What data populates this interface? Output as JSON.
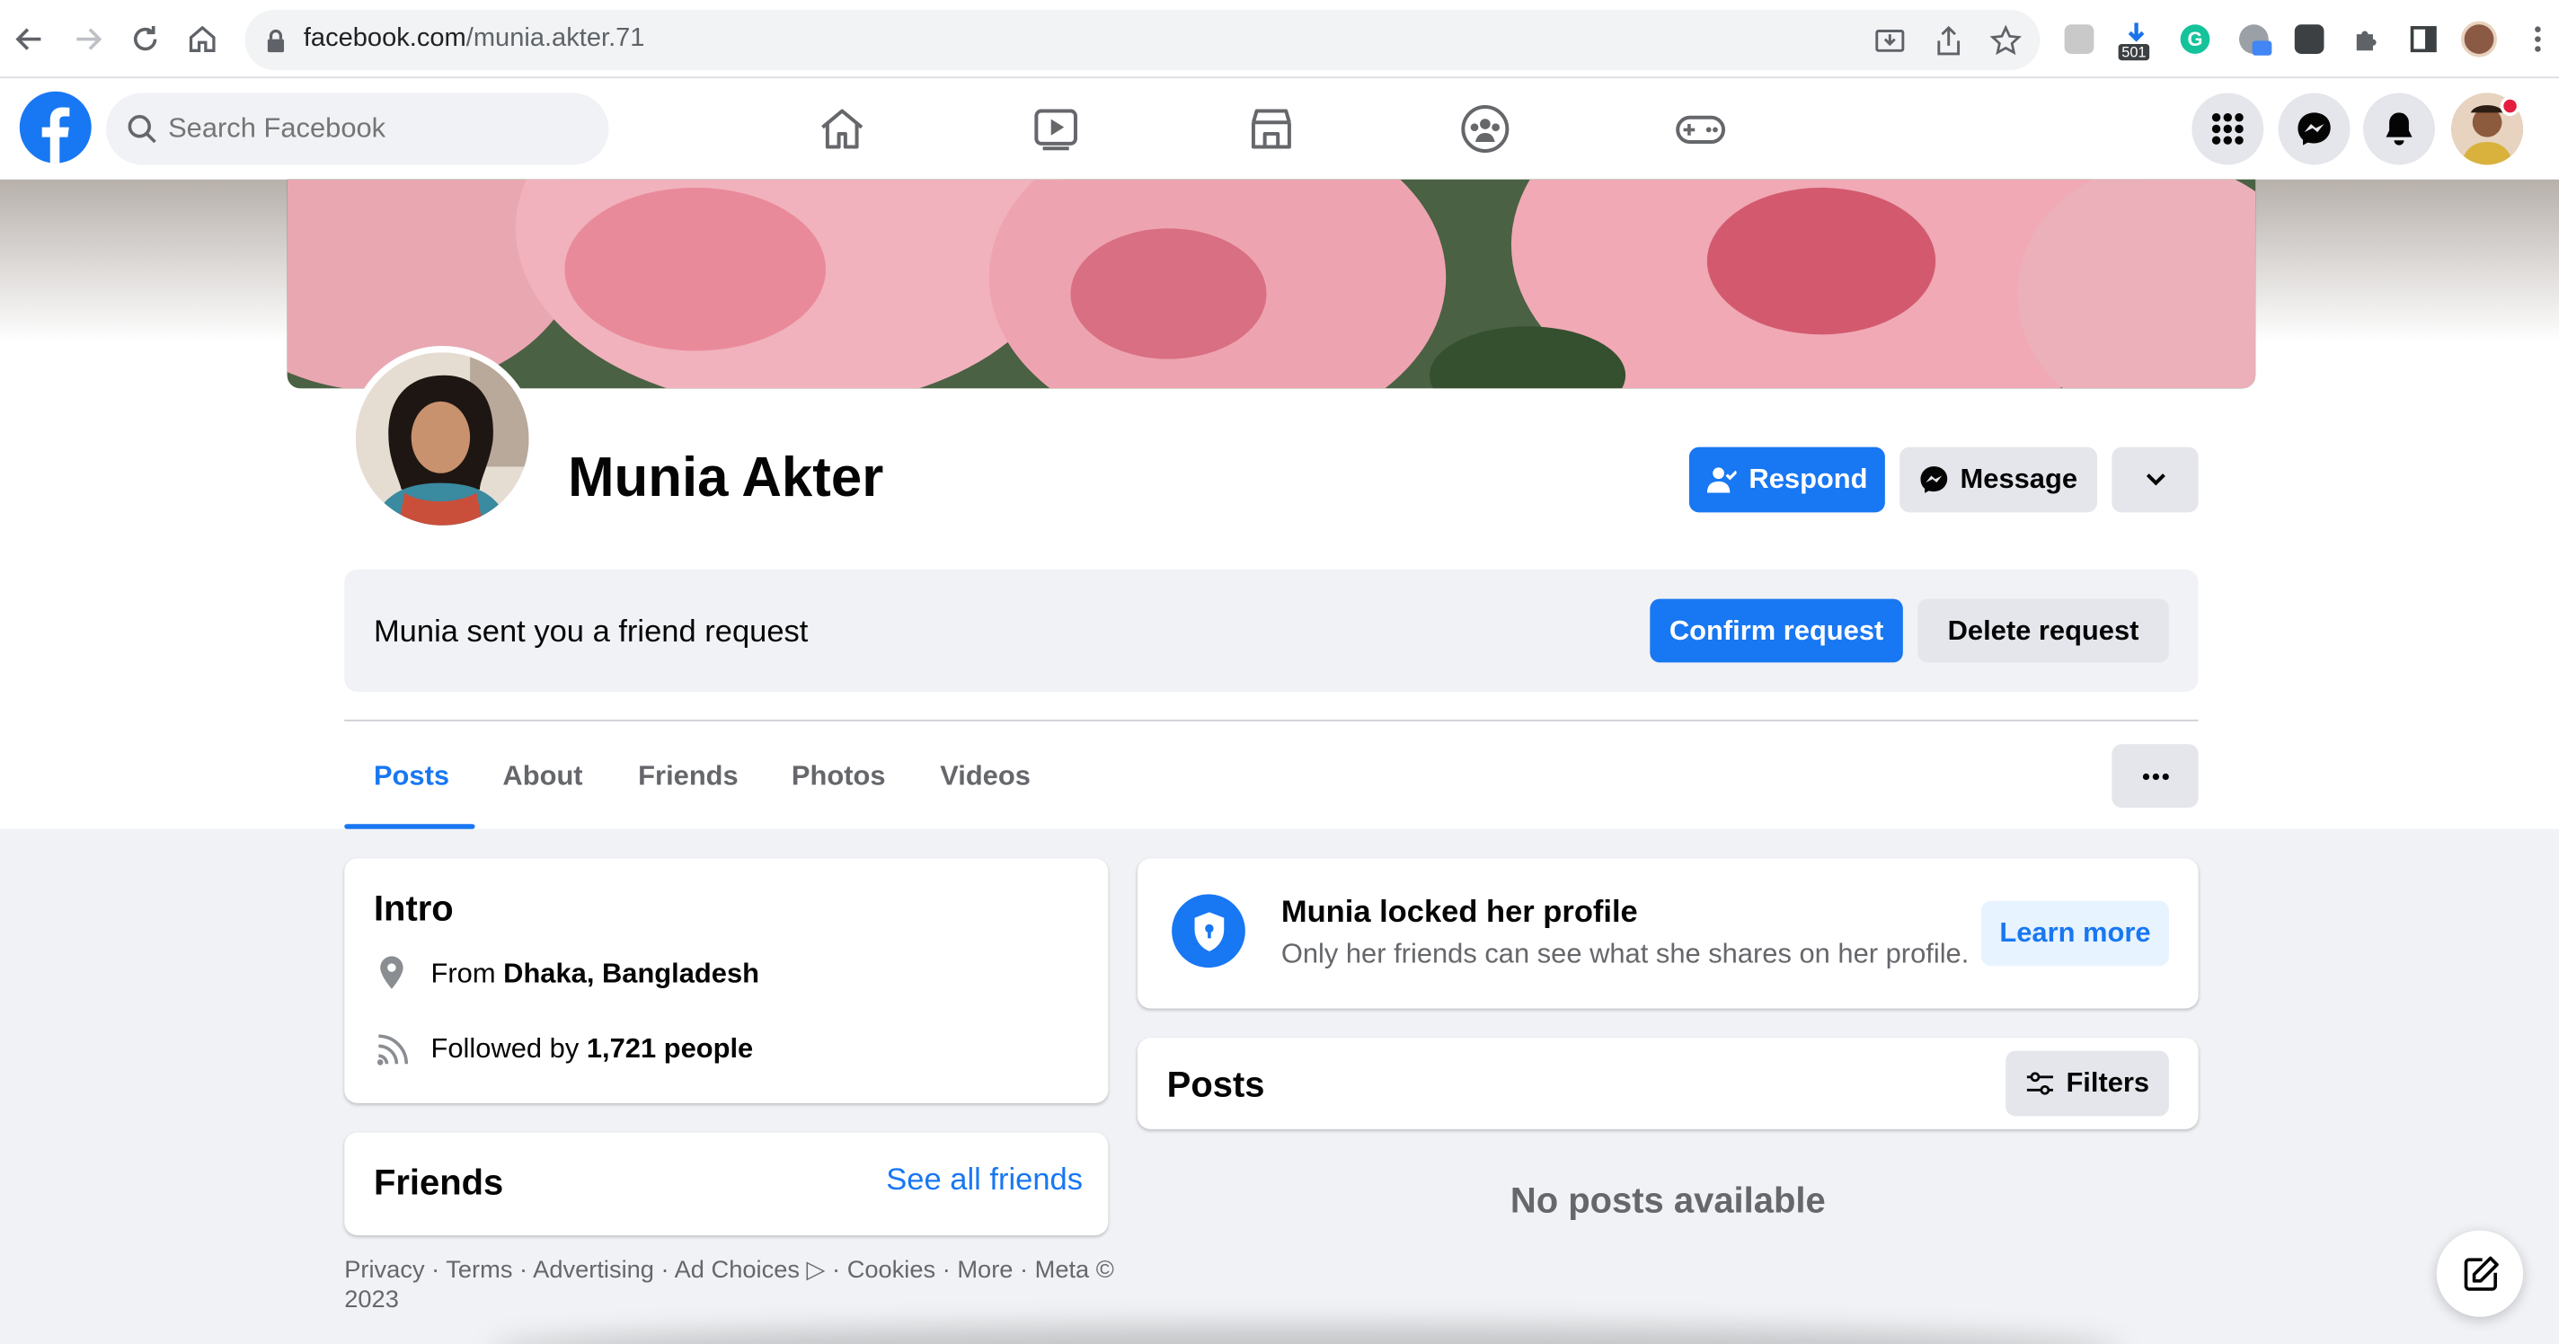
{
  "browser": {
    "url_host": "facebook.com",
    "url_path": "/munia.akter.71",
    "download_badge": "501"
  },
  "header": {
    "search_placeholder": "Search Facebook"
  },
  "profile": {
    "name": "Munia Akter",
    "respond_label": "Respond",
    "message_label": "Message"
  },
  "friend_request": {
    "text": "Munia sent you a friend request",
    "confirm_label": "Confirm request",
    "delete_label": "Delete request"
  },
  "tabs": [
    {
      "label": "Posts",
      "active": true
    },
    {
      "label": "About"
    },
    {
      "label": "Friends"
    },
    {
      "label": "Photos"
    },
    {
      "label": "Videos"
    }
  ],
  "intro": {
    "title": "Intro",
    "from_prefix": "From ",
    "from_place": "Dhaka, Bangladesh",
    "followed_prefix": "Followed by ",
    "followed_count": "1,721 people"
  },
  "friends_card": {
    "title": "Friends",
    "see_all": "See all friends"
  },
  "footer": {
    "text": "Privacy · Terms · Advertising · Ad Choices ▷ · Cookies · More · Meta © 2023"
  },
  "locked": {
    "title": "Munia locked her profile",
    "subtitle": "Only her friends can see what she shares on her profile.",
    "learn_more": "Learn more"
  },
  "posts": {
    "title": "Posts",
    "filters_label": "Filters",
    "empty": "No posts available"
  },
  "colors": {
    "brand": "#1877f2",
    "background": "#f0f2f5",
    "secondary_text": "#65676b"
  }
}
